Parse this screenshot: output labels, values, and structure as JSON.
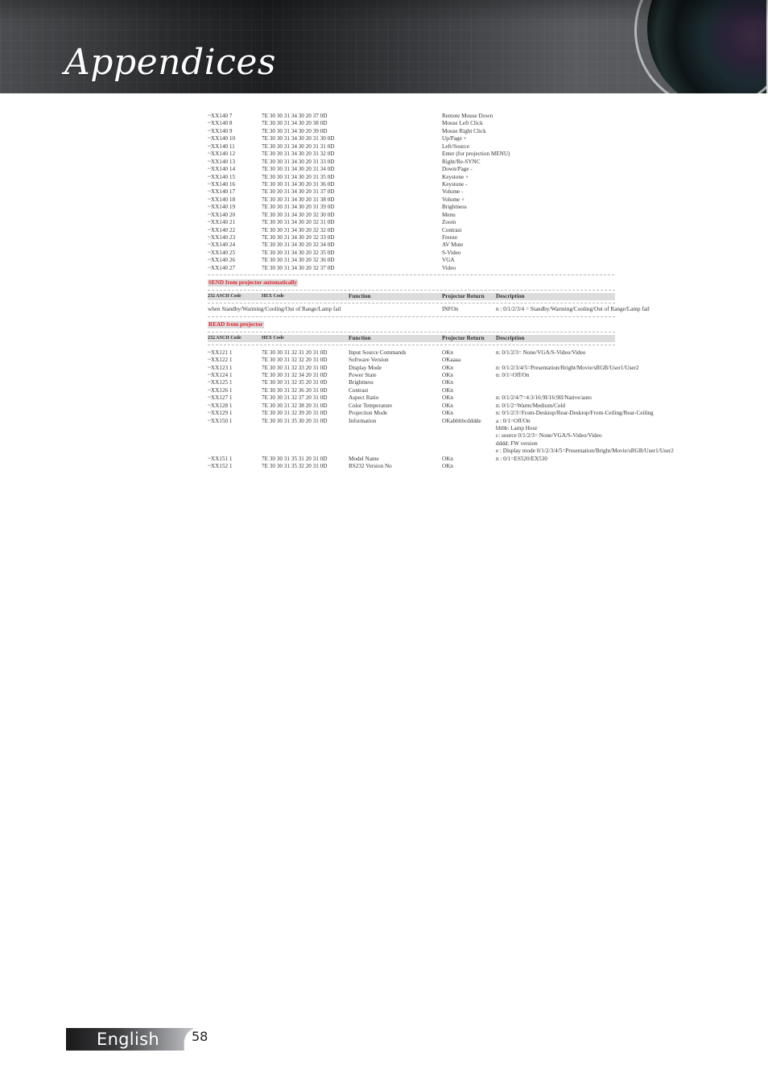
{
  "header": {
    "title": "Appendices"
  },
  "remote_commands": [
    {
      "ascii": "~XX140 7",
      "hex": "7E 30 30 31 34 30 20 37 0D",
      "function": "Remote Mouse Down"
    },
    {
      "ascii": "~XX140 8",
      "hex": "7E 30 30 31 34 30 20 38 0D",
      "function": "Mouse Left Click"
    },
    {
      "ascii": "~XX140 9",
      "hex": "7E 30 30 31 34 30 20 39 0D",
      "function": "Mouse Right Click"
    },
    {
      "ascii": "~XX140 10",
      "hex": "7E 30 30 31 34 30 20 31 30 0D",
      "function": "Up/Page +"
    },
    {
      "ascii": "~XX140 11",
      "hex": "7E 30 30 31 34 30 20 31 31 0D",
      "function": "Left/Source"
    },
    {
      "ascii": "~XX140 12",
      "hex": "7E 30 30 31 34 30 20 31 32 0D",
      "function": "Enter (for projection MENU)"
    },
    {
      "ascii": "~XX140 13",
      "hex": "7E 30 30 31 34 30 20 31 33 0D",
      "function": "Right/Re-SYNC"
    },
    {
      "ascii": "~XX140 14",
      "hex": "7E 30 30 31 34 30 20 31 34 0D",
      "function": "Down/Page -"
    },
    {
      "ascii": "~XX140 15",
      "hex": "7E 30 30 31 34 30 20 31 35 0D",
      "function": "Keystone +"
    },
    {
      "ascii": "~XX140 16",
      "hex": "7E 30 30 31 34 30 20 31 36 0D",
      "function": "Keystone -"
    },
    {
      "ascii": "~XX140 17",
      "hex": "7E 30 30 31 34 30 20 31 37 0D",
      "function": "Volume -"
    },
    {
      "ascii": "~XX140 18",
      "hex": "7E 30 30 31 34 30 20 31 38 0D",
      "function": "Volume +"
    },
    {
      "ascii": "~XX140 19",
      "hex": "7E 30 30 31 34 30 20 31 39 0D",
      "function": "Brightness"
    },
    {
      "ascii": "~XX140 20",
      "hex": "7E 30 30 31 34 30 20 32 30 0D",
      "function": "Menu"
    },
    {
      "ascii": "~XX140 21",
      "hex": "7E 30 30 31 34 30 20 32 31 0D",
      "function": "Zoom"
    },
    {
      "ascii": "~XX140 22",
      "hex": "7E 30 30 31 34 30 20 32 32 0D",
      "function": "Contrast"
    },
    {
      "ascii": "~XX140 23",
      "hex": "7E 30 30 31 34 30 20 32 33 0D",
      "function": "Freeze"
    },
    {
      "ascii": "~XX140 24",
      "hex": "7E 30 30 31 34 30 20 32 34 0D",
      "function": "AV Mute"
    },
    {
      "ascii": "~XX140 25",
      "hex": "7E 30 30 31 34 30 20 32 35 0D",
      "function": "S-Video"
    },
    {
      "ascii": "~XX140 26",
      "hex": "7E 30 30 31 34 30 20 32 36 0D",
      "function": "VGA"
    },
    {
      "ascii": "~XX140 27",
      "hex": "7E 30 30 31 34 30 20 32 37 0D",
      "function": "Video"
    }
  ],
  "table_headers": {
    "ascii": "232 ASCII Code",
    "hex": "HEX Code",
    "function": "Function",
    "return": "Projector Return",
    "description": "Description"
  },
  "send_section": {
    "label": "SEND from projector automatically",
    "rows": [
      {
        "condition": "when Standby/Warming/Cooling/Out of Range/Lamp fail",
        "return": "INFOn",
        "description": "n : 0/1/2/3/4 = Standby/Warming/Cooling/Out of Range/Lamp fail"
      }
    ]
  },
  "read_section": {
    "label": "READ from projector",
    "rows": [
      {
        "ascii": "~XX121 1",
        "hex": "7E 30 30 31 32 31 20 31 0D",
        "function": "Input Source Commands",
        "return": "OKn",
        "description": [
          "n: 0/1/2/3= None/VGA/S-Video/Video"
        ]
      },
      {
        "ascii": "~XX122 1",
        "hex": "7E 30 30 31 32 32 20 31 0D",
        "function": "Software Version",
        "return": "OKaaaa",
        "description": []
      },
      {
        "ascii": "~XX123 1",
        "hex": "7E 30 30 31 32 33 20 31 0D",
        "function": "Display Mode",
        "return": "OKn",
        "description": [
          "n: 0/1/2/3/4/5=Presentation/Bright/Movie/sRGB/User1/User2"
        ]
      },
      {
        "ascii": "~XX124 1",
        "hex": "7E 30 30 31 32 34 20 31 0D",
        "function": "Power State",
        "return": "OKn",
        "description": [
          "n: 0/1=Off/On"
        ]
      },
      {
        "ascii": "~XX125 1",
        "hex": "7E 30 30 31 32 35 20 31 0D",
        "function": "Brightness",
        "return": "OKn",
        "description": []
      },
      {
        "ascii": "~XX126 1",
        "hex": "7E 30 30 31 32 36 20 31 0D",
        "function": "Contrast",
        "return": "OKn",
        "description": []
      },
      {
        "ascii": "~XX127 1",
        "hex": "7E 30 30 31 32 37 20 31 0D",
        "function": "Aspect Ratio",
        "return": "OKn",
        "description": [
          "n: 0/1/2/4/7=4:3/16:9I/16:9II/Native/auto"
        ]
      },
      {
        "ascii": "~XX128 1",
        "hex": "7E 30 30 31 32 38 20 31 0D",
        "function": "Color Temperature",
        "return": "OKn",
        "description": [
          "n: 0/1/2=Warm/Medium/Cold"
        ]
      },
      {
        "ascii": "~XX129 1",
        "hex": "7E 30 30 31 32 39 20 31 0D",
        "function": "Projection Mode",
        "return": "OKn",
        "description": [
          "n: 0/1/2/3=Front-Desktop/Rear-Desktop/Front-Ceiling/Rear-Ceiling"
        ]
      },
      {
        "ascii": "~XX150 1",
        "hex": "7E 30 30 31 35 30 20 31 0D",
        "function": "Information",
        "return": "OKabbbbcdddde",
        "description": [
          "a : 0/1=Off/On",
          "bbbb: Lamp Hour",
          "c: source 0/1/2/3= None/VGA/S-Video/Video",
          "dddd: FW version",
          "e : Display mode 0/1/2/3/4/5=Presentation/Bright/Movie/sRGB/User1/User2"
        ]
      },
      {
        "ascii": "~XX151 1",
        "hex": "7E 30 30 31 35 31 20 31 0D",
        "function": "Model Name",
        "return": "OKn",
        "description": [
          "n : 0/1=ES520/EX530"
        ]
      },
      {
        "ascii": "~XX152 1",
        "hex": "7E 30 30 31 35 32 20 31 0D",
        "function": "RS232 Version No",
        "return": "OKn",
        "description": []
      }
    ]
  },
  "footer": {
    "language": "English",
    "page_number": "58"
  },
  "colors": {
    "section_label": "#e3222b",
    "header_bg": "#dcdcdc"
  }
}
